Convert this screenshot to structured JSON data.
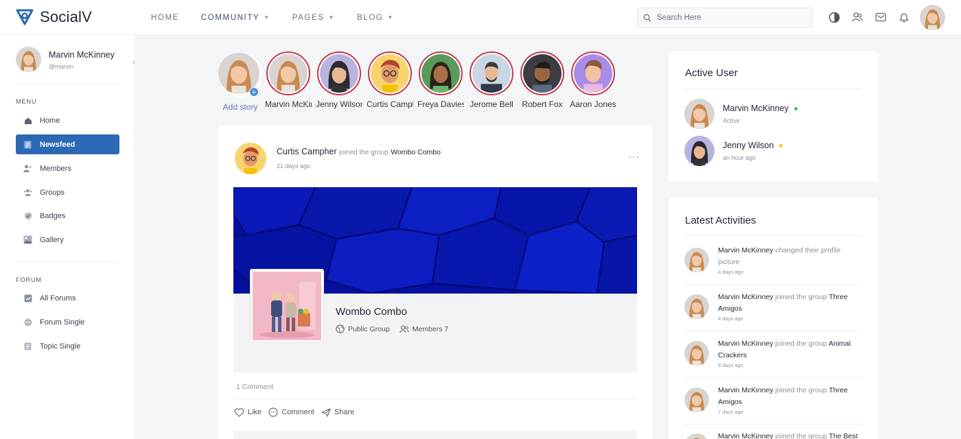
{
  "app": {
    "name": "SocialV"
  },
  "nav": {
    "items": [
      {
        "label": "HOME",
        "has_dropdown": false
      },
      {
        "label": "COMMUNITY",
        "has_dropdown": true
      },
      {
        "label": "PAGES",
        "has_dropdown": true
      },
      {
        "label": "BLOG",
        "has_dropdown": true
      }
    ]
  },
  "search": {
    "placeholder": "Search Here"
  },
  "top_icons": [
    "contrast-icon",
    "friends-icon",
    "mail-icon",
    "bell-icon"
  ],
  "sidebar": {
    "user": {
      "name": "Marvin McKinney",
      "handle": "@marvin"
    },
    "menu_label": "MENU",
    "menu": [
      {
        "label": "Home",
        "icon": "home-icon"
      },
      {
        "label": "Newsfeed",
        "icon": "newsfeed-icon",
        "active": true
      },
      {
        "label": "Members",
        "icon": "members-icon"
      },
      {
        "label": "Groups",
        "icon": "groups-icon"
      },
      {
        "label": "Badges",
        "icon": "badge-icon"
      },
      {
        "label": "Gallery",
        "icon": "gallery-icon"
      }
    ],
    "forum_label": "FORUM",
    "forum": [
      {
        "label": "All Forums",
        "icon": "forums-icon"
      },
      {
        "label": "Forum Single",
        "icon": "forum-single-icon"
      },
      {
        "label": "Topic Single",
        "icon": "topic-icon"
      }
    ]
  },
  "stories": [
    {
      "label": "Add story",
      "add": true
    },
    {
      "label": "Marvin McKinney"
    },
    {
      "label": "Jenny Wilson"
    },
    {
      "label": "Curtis Campher"
    },
    {
      "label": "Freya Davies"
    },
    {
      "label": "Jerome Bell"
    },
    {
      "label": "Robert Fox"
    },
    {
      "label": "Aaron Jones"
    }
  ],
  "post": {
    "author": "Curtis Campher",
    "action": "joined the group",
    "group": "Wombo Combo",
    "time": "21 days ago",
    "group_name": "Wombo Combo",
    "group_type": "Public Group",
    "members": "Members 7",
    "comments_count": "1 Comment",
    "actions": {
      "like": "Like",
      "comment": "Comment",
      "share": "Share"
    }
  },
  "active_users": {
    "title": "Active User",
    "users": [
      {
        "name": "Marvin McKinney",
        "status": "Active",
        "dot_color": "#2ecc71"
      },
      {
        "name": "Jenny Wilson",
        "status": "an hour ago",
        "dot_color": "#f5c518"
      }
    ]
  },
  "latest": {
    "title": "Latest Activities",
    "items": [
      {
        "who": "Marvin McKinney",
        "action": "changed their profile picture",
        "group": "",
        "when": "4 days ago"
      },
      {
        "who": "Marvin McKinney",
        "action": "joined the group",
        "group": "Three Amigos",
        "when": "4 days ago"
      },
      {
        "who": "Marvin McKinney",
        "action": "joined the group",
        "group": "Animal Crackers",
        "when": "6 days ago"
      },
      {
        "who": "Marvin McKinney",
        "action": "joined the group",
        "group": "Three Amigos",
        "when": "7 days ago"
      },
      {
        "who": "Marvin McKinney",
        "action": "joined the group",
        "group": "The Best",
        "when": ""
      }
    ]
  }
}
